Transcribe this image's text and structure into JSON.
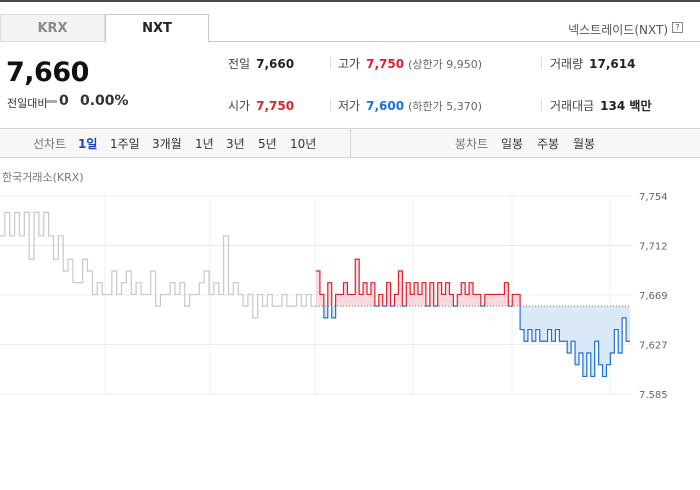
{
  "tabs": {
    "krx": "KRX",
    "nxt": "NXT"
  },
  "source_label": "넥스트레이드(NXT)",
  "help_icon": "?",
  "price": {
    "current": "7,660",
    "change_label": "전일대비",
    "change_value": "0",
    "change_rate": "0.00%"
  },
  "stats": {
    "prev_close_label": "전일",
    "prev_close": "7,660",
    "high_label": "고가",
    "high": "7,750",
    "upper_limit_label": "(상한가 9,950)",
    "volume_label": "거래량",
    "volume": "17,614",
    "open_label": "시가",
    "open": "7,750",
    "low_label": "저가",
    "low": "7,600",
    "lower_limit_label": "(하한가 5,370)",
    "amount_label": "거래대금",
    "amount": "134 백만"
  },
  "period": {
    "line_label": "선차트",
    "line_options": [
      "1일",
      "1주일",
      "3개월",
      "1년",
      "3년",
      "5년",
      "10년"
    ],
    "active": "1일",
    "candle_label": "봉차트",
    "candle_options": [
      "일봉",
      "주봉",
      "월봉"
    ]
  },
  "colors": {
    "up": "#e0202a",
    "down": "#1f6fd6",
    "active": "#1c46b8",
    "krx_line": "#c8c8c8"
  },
  "chart_data": {
    "type": "line",
    "title": "한국거래소(KRX)",
    "baseline": 7660,
    "ylim": [
      7585,
      7754
    ],
    "y_ticks": [
      "7,754",
      "7,712",
      "7,669",
      "7,627",
      "7,585"
    ],
    "grid": true,
    "series": [
      {
        "name": "KRX",
        "values": [
          7720,
          7740,
          7720,
          7740,
          7720,
          7740,
          7700,
          7740,
          7720,
          7740,
          7720,
          7700,
          7720,
          7690,
          7700,
          7680,
          7680,
          7700,
          7690,
          7670,
          7680,
          7670,
          7670,
          7690,
          7670,
          7680,
          7690,
          7670,
          7680,
          7670,
          7670,
          7690,
          7660,
          7670,
          7670,
          7680,
          7670,
          7680,
          7660,
          7670,
          7670,
          7680,
          7690,
          7670,
          7680,
          7670,
          7720,
          7670,
          7680,
          7670,
          7660,
          7670,
          7650,
          7670,
          7660,
          7670,
          7660,
          7660,
          7670,
          7660,
          7660,
          7670,
          7660,
          7670,
          7660,
          7660
        ]
      },
      {
        "name": "NXT",
        "values": [
          7690,
          7670,
          7650,
          7680,
          7650,
          7670,
          7670,
          7680,
          7670,
          7670,
          7700,
          7670,
          7680,
          7670,
          7680,
          7660,
          7670,
          7660,
          7680,
          7660,
          7670,
          7690,
          7660,
          7680,
          7670,
          7680,
          7670,
          7680,
          7660,
          7680,
          7660,
          7680,
          7670,
          7680,
          7670,
          7660,
          7670,
          7680,
          7670,
          7680,
          7670,
          7670,
          7660,
          7670,
          7670,
          7670,
          7670,
          7670,
          7680,
          7660,
          7670,
          7670,
          7640,
          7630,
          7640,
          7630,
          7640,
          7630,
          7630,
          7640,
          7630,
          7640,
          7630,
          7630,
          7620,
          7630,
          7610,
          7620,
          7600,
          7620,
          7600,
          7630,
          7610,
          7600,
          7610,
          7620,
          7640,
          7620,
          7650,
          7630,
          7630
        ]
      }
    ]
  }
}
